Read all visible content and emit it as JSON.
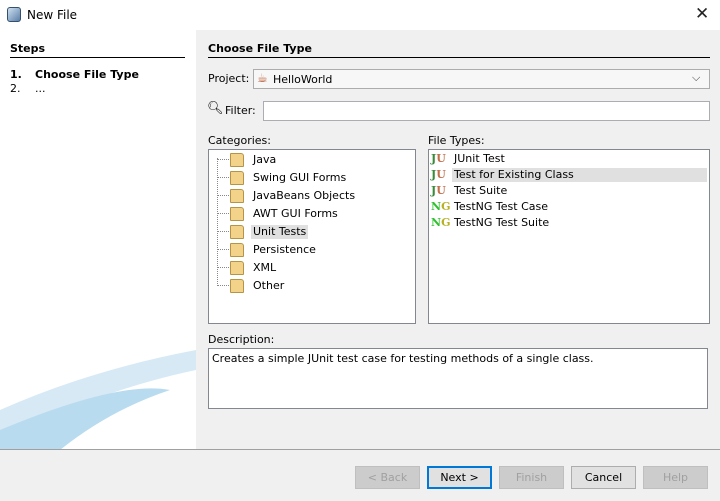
{
  "window": {
    "title": "New File"
  },
  "steps": {
    "header": "Steps",
    "items": [
      {
        "num": "1.",
        "label": "Choose File Type"
      },
      {
        "num": "2.",
        "label": "..."
      }
    ]
  },
  "main": {
    "header": "Choose File Type",
    "project_label": "Project:",
    "project_value": "HelloWorld",
    "filter_label": "Filter:",
    "filter_value": "",
    "categories_label": "Categories:",
    "categories": [
      "Java",
      "Swing GUI Forms",
      "JavaBeans Objects",
      "AWT GUI Forms",
      "Unit Tests",
      "Persistence",
      "XML",
      "Other"
    ],
    "file_types_label": "File Types:",
    "file_types": [
      {
        "icon": "JU",
        "label": "JUnit Test"
      },
      {
        "icon": "JU",
        "label": "Test for Existing Class"
      },
      {
        "icon": "JU",
        "label": "Test Suite"
      },
      {
        "icon": "NG",
        "label": "TestNG Test Case"
      },
      {
        "icon": "NG",
        "label": "TestNG Test Suite"
      }
    ],
    "description_label": "Description:",
    "description": "Creates a simple JUnit test case for testing methods of a single class."
  },
  "buttons": {
    "back": "< Back",
    "next": "Next >",
    "finish": "Finish",
    "cancel": "Cancel",
    "help": "Help"
  }
}
